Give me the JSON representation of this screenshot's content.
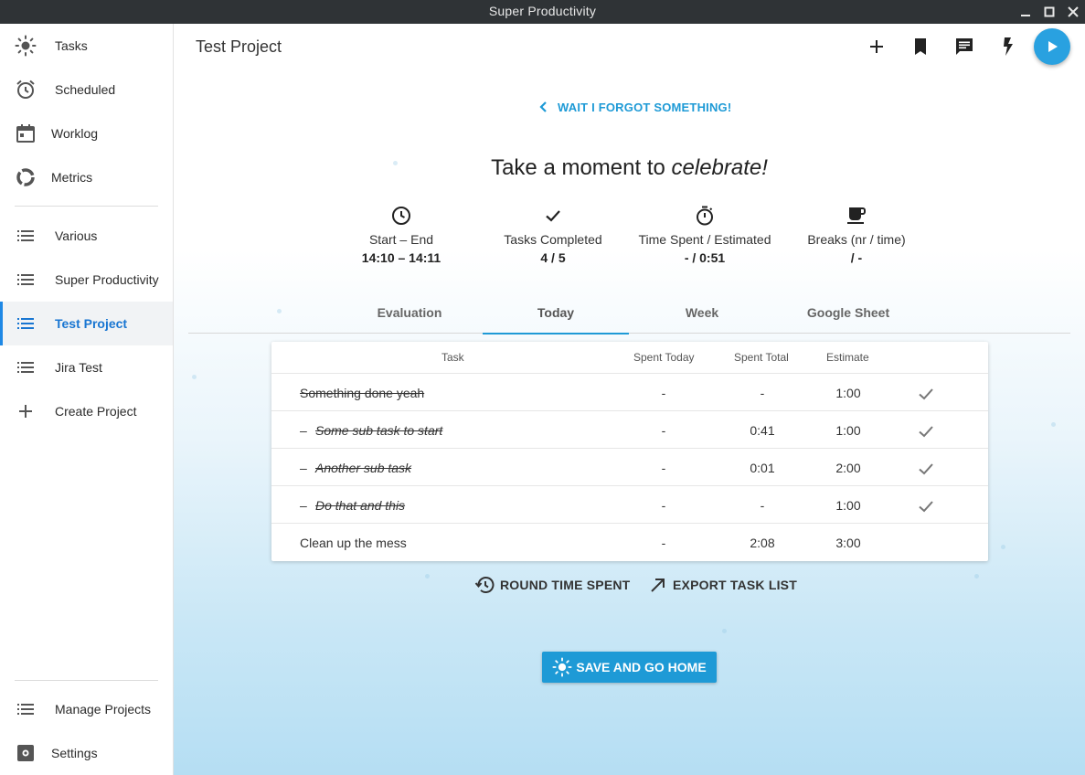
{
  "window": {
    "title": "Super Productivity"
  },
  "sidebar": {
    "items": [
      {
        "label": "Tasks",
        "icon": "sun-icon"
      },
      {
        "label": "Scheduled",
        "icon": "alarm-icon"
      },
      {
        "label": "Worklog",
        "icon": "calendar-icon"
      },
      {
        "label": "Metrics",
        "icon": "donut-chart-icon"
      },
      {
        "label": "Various",
        "icon": "list-icon"
      },
      {
        "label": "Super Productivity",
        "icon": "list-icon"
      },
      {
        "label": "Test Project",
        "icon": "list-icon",
        "active": true
      },
      {
        "label": "Jira Test",
        "icon": "list-icon"
      },
      {
        "label": "Create Project",
        "icon": "plus-icon"
      }
    ],
    "bottom": [
      {
        "label": "Manage Projects",
        "icon": "list-icon"
      },
      {
        "label": "Settings",
        "icon": "settings-icon"
      }
    ]
  },
  "header": {
    "title": "Test Project"
  },
  "main": {
    "back_link": "WAIT I FORGOT SOMETHING!",
    "headline_prefix": "Take a moment to ",
    "headline_emphasis": "celebrate!",
    "stats": [
      {
        "icon": "clock-icon",
        "label": "Start – End",
        "value": "14:10 – 14:11"
      },
      {
        "icon": "check-icon",
        "label": "Tasks Completed",
        "value": "4 / 5"
      },
      {
        "icon": "timer-icon",
        "label": "Time Spent / Estimated",
        "value": "- / 0:51"
      },
      {
        "icon": "coffee-icon",
        "label": "Breaks (nr / time)",
        "value": "/ -"
      }
    ],
    "tabs": [
      "Evaluation",
      "Today",
      "Week",
      "Google Sheet"
    ],
    "active_tab": "Today",
    "table": {
      "headers": {
        "task": "Task",
        "spent_today": "Spent Today",
        "spent_total": "Spent Total",
        "estimate": "Estimate"
      },
      "rows": [
        {
          "task": "Something done yeah",
          "prefix": "",
          "spent_today": "-",
          "spent_total": "-",
          "estimate": "1:00",
          "done": true,
          "sub": false
        },
        {
          "task": "Some sub task to start",
          "prefix": "–",
          "spent_today": "-",
          "spent_total": "0:41",
          "estimate": "1:00",
          "done": true,
          "sub": true
        },
        {
          "task": "Another sub task",
          "prefix": "–",
          "spent_today": "-",
          "spent_total": "0:01",
          "estimate": "2:00",
          "done": true,
          "sub": true
        },
        {
          "task": "Do that and this",
          "prefix": "–",
          "spent_today": "-",
          "spent_total": "-",
          "estimate": "1:00",
          "done": true,
          "sub": true
        },
        {
          "task": "Clean up the mess",
          "prefix": "",
          "spent_today": "-",
          "spent_total": "2:08",
          "estimate": "3:00",
          "done": false,
          "sub": false
        }
      ]
    },
    "actions": {
      "round": "ROUND TIME SPENT",
      "export": "EXPORT TASK LIST"
    },
    "save_button": "SAVE AND GO HOME"
  },
  "colors": {
    "accent": "#1e9ad6",
    "active_nav": "#1976d2",
    "titlebar": "#2f3336"
  }
}
